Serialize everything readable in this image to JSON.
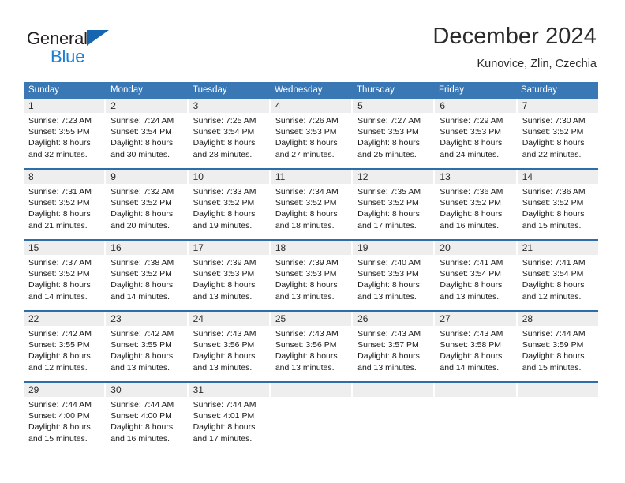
{
  "brand": {
    "name_part1": "General",
    "name_part2": "Blue",
    "triangle_color": "#1565b0",
    "blue_text_color": "#1b7fd4"
  },
  "header": {
    "title": "December 2024",
    "location": "Kunovice, Zlin, Czechia"
  },
  "theme": {
    "header_row_bg": "#3a77b5",
    "daynum_bg": "#eeeeee",
    "week_separator": "#2e6da8",
    "text": "#1a1a1a"
  },
  "weekdays": [
    "Sunday",
    "Monday",
    "Tuesday",
    "Wednesday",
    "Thursday",
    "Friday",
    "Saturday"
  ],
  "weeks": [
    {
      "days": [
        {
          "num": "1",
          "lines": [
            "Sunrise: 7:23 AM",
            "Sunset: 3:55 PM",
            "Daylight: 8 hours",
            "and 32 minutes."
          ]
        },
        {
          "num": "2",
          "lines": [
            "Sunrise: 7:24 AM",
            "Sunset: 3:54 PM",
            "Daylight: 8 hours",
            "and 30 minutes."
          ]
        },
        {
          "num": "3",
          "lines": [
            "Sunrise: 7:25 AM",
            "Sunset: 3:54 PM",
            "Daylight: 8 hours",
            "and 28 minutes."
          ]
        },
        {
          "num": "4",
          "lines": [
            "Sunrise: 7:26 AM",
            "Sunset: 3:53 PM",
            "Daylight: 8 hours",
            "and 27 minutes."
          ]
        },
        {
          "num": "5",
          "lines": [
            "Sunrise: 7:27 AM",
            "Sunset: 3:53 PM",
            "Daylight: 8 hours",
            "and 25 minutes."
          ]
        },
        {
          "num": "6",
          "lines": [
            "Sunrise: 7:29 AM",
            "Sunset: 3:53 PM",
            "Daylight: 8 hours",
            "and 24 minutes."
          ]
        },
        {
          "num": "7",
          "lines": [
            "Sunrise: 7:30 AM",
            "Sunset: 3:52 PM",
            "Daylight: 8 hours",
            "and 22 minutes."
          ]
        }
      ]
    },
    {
      "days": [
        {
          "num": "8",
          "lines": [
            "Sunrise: 7:31 AM",
            "Sunset: 3:52 PM",
            "Daylight: 8 hours",
            "and 21 minutes."
          ]
        },
        {
          "num": "9",
          "lines": [
            "Sunrise: 7:32 AM",
            "Sunset: 3:52 PM",
            "Daylight: 8 hours",
            "and 20 minutes."
          ]
        },
        {
          "num": "10",
          "lines": [
            "Sunrise: 7:33 AM",
            "Sunset: 3:52 PM",
            "Daylight: 8 hours",
            "and 19 minutes."
          ]
        },
        {
          "num": "11",
          "lines": [
            "Sunrise: 7:34 AM",
            "Sunset: 3:52 PM",
            "Daylight: 8 hours",
            "and 18 minutes."
          ]
        },
        {
          "num": "12",
          "lines": [
            "Sunrise: 7:35 AM",
            "Sunset: 3:52 PM",
            "Daylight: 8 hours",
            "and 17 minutes."
          ]
        },
        {
          "num": "13",
          "lines": [
            "Sunrise: 7:36 AM",
            "Sunset: 3:52 PM",
            "Daylight: 8 hours",
            "and 16 minutes."
          ]
        },
        {
          "num": "14",
          "lines": [
            "Sunrise: 7:36 AM",
            "Sunset: 3:52 PM",
            "Daylight: 8 hours",
            "and 15 minutes."
          ]
        }
      ]
    },
    {
      "days": [
        {
          "num": "15",
          "lines": [
            "Sunrise: 7:37 AM",
            "Sunset: 3:52 PM",
            "Daylight: 8 hours",
            "and 14 minutes."
          ]
        },
        {
          "num": "16",
          "lines": [
            "Sunrise: 7:38 AM",
            "Sunset: 3:52 PM",
            "Daylight: 8 hours",
            "and 14 minutes."
          ]
        },
        {
          "num": "17",
          "lines": [
            "Sunrise: 7:39 AM",
            "Sunset: 3:53 PM",
            "Daylight: 8 hours",
            "and 13 minutes."
          ]
        },
        {
          "num": "18",
          "lines": [
            "Sunrise: 7:39 AM",
            "Sunset: 3:53 PM",
            "Daylight: 8 hours",
            "and 13 minutes."
          ]
        },
        {
          "num": "19",
          "lines": [
            "Sunrise: 7:40 AM",
            "Sunset: 3:53 PM",
            "Daylight: 8 hours",
            "and 13 minutes."
          ]
        },
        {
          "num": "20",
          "lines": [
            "Sunrise: 7:41 AM",
            "Sunset: 3:54 PM",
            "Daylight: 8 hours",
            "and 13 minutes."
          ]
        },
        {
          "num": "21",
          "lines": [
            "Sunrise: 7:41 AM",
            "Sunset: 3:54 PM",
            "Daylight: 8 hours",
            "and 12 minutes."
          ]
        }
      ]
    },
    {
      "days": [
        {
          "num": "22",
          "lines": [
            "Sunrise: 7:42 AM",
            "Sunset: 3:55 PM",
            "Daylight: 8 hours",
            "and 12 minutes."
          ]
        },
        {
          "num": "23",
          "lines": [
            "Sunrise: 7:42 AM",
            "Sunset: 3:55 PM",
            "Daylight: 8 hours",
            "and 13 minutes."
          ]
        },
        {
          "num": "24",
          "lines": [
            "Sunrise: 7:43 AM",
            "Sunset: 3:56 PM",
            "Daylight: 8 hours",
            "and 13 minutes."
          ]
        },
        {
          "num": "25",
          "lines": [
            "Sunrise: 7:43 AM",
            "Sunset: 3:56 PM",
            "Daylight: 8 hours",
            "and 13 minutes."
          ]
        },
        {
          "num": "26",
          "lines": [
            "Sunrise: 7:43 AM",
            "Sunset: 3:57 PM",
            "Daylight: 8 hours",
            "and 13 minutes."
          ]
        },
        {
          "num": "27",
          "lines": [
            "Sunrise: 7:43 AM",
            "Sunset: 3:58 PM",
            "Daylight: 8 hours",
            "and 14 minutes."
          ]
        },
        {
          "num": "28",
          "lines": [
            "Sunrise: 7:44 AM",
            "Sunset: 3:59 PM",
            "Daylight: 8 hours",
            "and 15 minutes."
          ]
        }
      ]
    },
    {
      "days": [
        {
          "num": "29",
          "lines": [
            "Sunrise: 7:44 AM",
            "Sunset: 4:00 PM",
            "Daylight: 8 hours",
            "and 15 minutes."
          ]
        },
        {
          "num": "30",
          "lines": [
            "Sunrise: 7:44 AM",
            "Sunset: 4:00 PM",
            "Daylight: 8 hours",
            "and 16 minutes."
          ]
        },
        {
          "num": "31",
          "lines": [
            "Sunrise: 7:44 AM",
            "Sunset: 4:01 PM",
            "Daylight: 8 hours",
            "and 17 minutes."
          ]
        },
        {
          "num": "",
          "lines": []
        },
        {
          "num": "",
          "lines": []
        },
        {
          "num": "",
          "lines": []
        },
        {
          "num": "",
          "lines": []
        }
      ]
    }
  ]
}
